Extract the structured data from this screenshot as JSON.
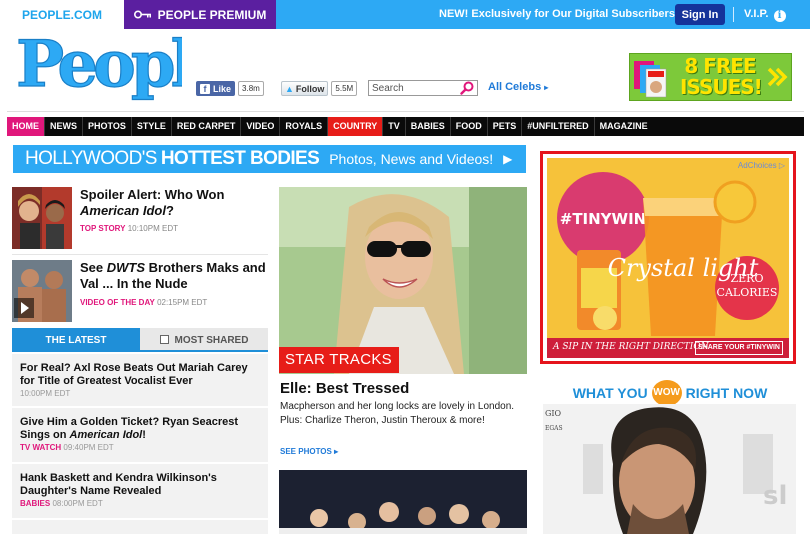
{
  "topbar": {
    "people_tab": "PEOPLE.COM",
    "premium_tab": "PEOPLE PREMIUM",
    "exclusive": "NEW! Exclusively for Our Digital Subscribers",
    "signin": "Sign In",
    "vip": "V.I.P."
  },
  "header": {
    "logo": "People",
    "fb_like": "Like",
    "fb_count": "3.8m",
    "tw_follow": "Follow",
    "tw_count": "5.5M",
    "search_placeholder": "Search",
    "all_celebs": "All Celebs",
    "ad_text_line1": "8 FREE",
    "ad_text_line2": "ISSUES!"
  },
  "nav": {
    "items": [
      "HOME",
      "NEWS",
      "PHOTOS",
      "STYLE",
      "RED CARPET",
      "VIDEO",
      "ROYALS",
      "COUNTRY",
      "TV",
      "BABIES",
      "FOOD",
      "PETS",
      "#UNFILTERED",
      "MAGAZINE"
    ]
  },
  "banner": {
    "light": "HOLLYWOOD'S",
    "bold": "HOTTEST BODIES",
    "sub": "Photos, News and Videos!"
  },
  "stories": [
    {
      "title_pre": "Spoiler Alert: Who Won ",
      "title_em": "American Idol",
      "title_post": "?",
      "tag": "TOP STORY",
      "time": "10:10PM EDT"
    },
    {
      "title_pre": "See ",
      "title_em": "DWTS",
      "title_post": " Brothers Maks and Val ... In the Nude",
      "tag": "VIDEO OF THE DAY",
      "time": "02:15PM EDT"
    }
  ],
  "tabs": {
    "latest": "THE LATEST",
    "shared": "MOST SHARED"
  },
  "latest": [
    {
      "title": "For Real? Axl Rose Beats Out Mariah Carey for Title of Greatest Vocalist Ever",
      "tag": "",
      "time": "10:00PM EDT"
    },
    {
      "title_pre": "Give Him a Golden Ticket? Ryan Seacrest Sings on ",
      "title_em": "American Idol",
      "title_post": "!",
      "tag": "TV WATCH",
      "time": "09:40PM EDT"
    },
    {
      "title": "Hank Baskett and Kendra Wilkinson's Daughter's Name Revealed",
      "tag": "BABIES",
      "time": "08:00PM EDT"
    }
  ],
  "feature": {
    "label": "STAR TRACKS",
    "title": "Elle: Best Tressed",
    "dek": "Macpherson and her long locks are lovely in London. Plus: Charlize Theron, Justin Theroux & more!",
    "see_photos": "SEE PHOTOS"
  },
  "ad": {
    "adchoices": "AdChoices",
    "slogan": "A SIP IN THE RIGHT DIRECTION",
    "share": "SHARE YOUR #TINYWIN",
    "hashtag": "#TINYWIN",
    "brand": "Crystal light",
    "badge": "ZERO CALORIES"
  },
  "wow": {
    "left": "WHAT YOU",
    "badge": "WOW",
    "right": "RIGHT NOW"
  },
  "colors": {
    "accent_blue": "#2da9f4",
    "premium_purple": "#5b1fa0",
    "home_pink": "#e0177b",
    "country_red": "#e71d18"
  }
}
